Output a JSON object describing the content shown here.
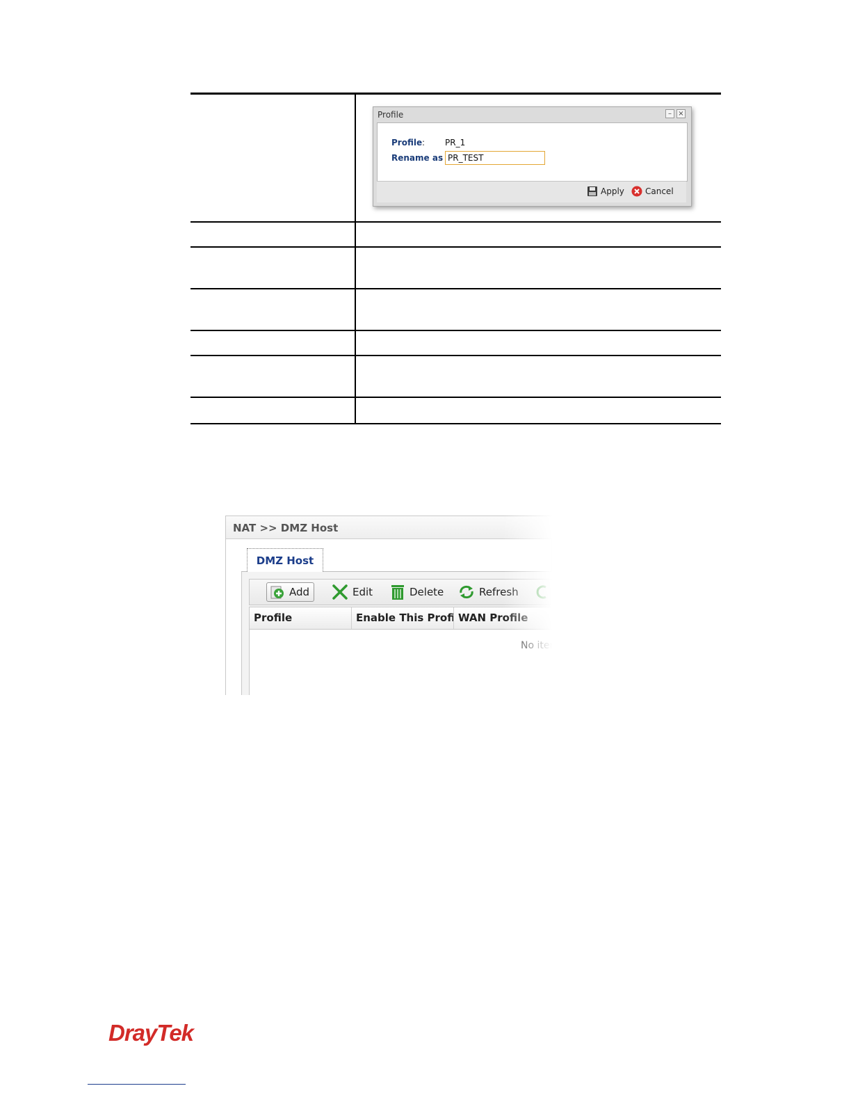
{
  "profile_dialog": {
    "title": "Profile",
    "minimize_glyph": "–",
    "close_glyph": "×",
    "profile_label": "Profile",
    "profile_colon": ":",
    "profile_value": "PR_1",
    "rename_label": "Rename as",
    "rename_colon": ":",
    "rename_value": "PR_TEST",
    "apply_label": "Apply",
    "cancel_label": "Cancel",
    "icons": {
      "apply": "floppy-disk-icon",
      "cancel": "red-x-circle-icon"
    }
  },
  "dmz": {
    "breadcrumb": "NAT >> DMZ Host",
    "tab": "DMZ Host",
    "toolbar": {
      "add": "Add",
      "edit": "Edit",
      "delete": "Delete",
      "refresh": "Refresh"
    },
    "columns": [
      "Profile",
      "Enable This Profile",
      "WAN Profile"
    ],
    "empty_text": "No iter"
  },
  "footer": {
    "logo": "DrayTek"
  },
  "colors": {
    "brand_red": "#d22b28",
    "label_blue": "#1b3d7a",
    "tab_blue": "#1b3d8a",
    "input_border": "#e3a634"
  }
}
